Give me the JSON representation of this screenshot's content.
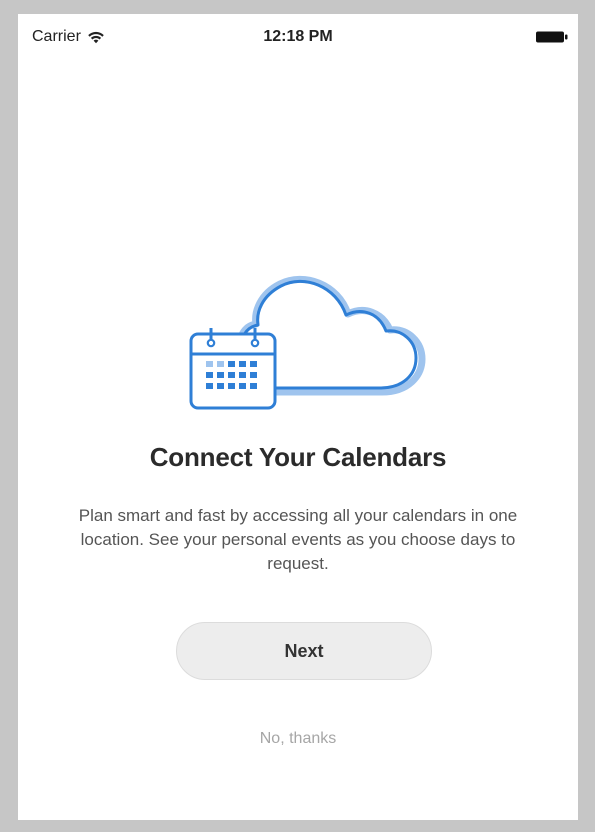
{
  "status_bar": {
    "carrier": "Carrier",
    "time": "12:18 PM",
    "wifi_icon": "wifi-icon",
    "battery_icon": "battery-icon"
  },
  "illustration": {
    "icon": "calendar-cloud-icon",
    "accent_color": "#2f7fd6",
    "light_color": "#9fc4ee"
  },
  "onboarding": {
    "title": "Connect Your Calendars",
    "description": "Plan smart and fast by accessing all your calendars in one location. See your personal events as you choose days to request.",
    "next_label": "Next",
    "skip_label": "No, thanks"
  }
}
